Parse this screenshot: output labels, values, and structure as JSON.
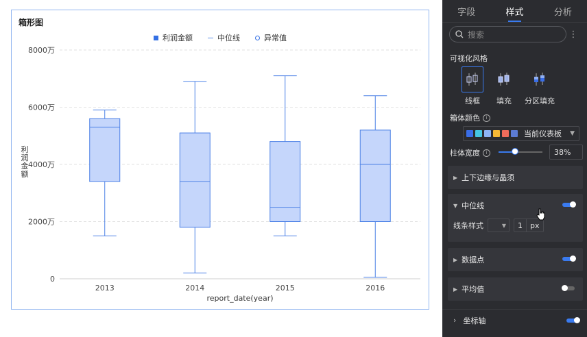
{
  "chart_data": {
    "type": "box",
    "title": "箱形图",
    "legend": [
      "利润金额",
      "中位线",
      "异常值"
    ],
    "xlabel": "report_date(year)",
    "ylabel": "利润金额",
    "ylim": [
      0,
      80000000
    ],
    "yticks": [
      0,
      20000000,
      40000000,
      60000000,
      80000000
    ],
    "ytick_labels": [
      "0",
      "2000万",
      "4000万",
      "6000万",
      "8000万"
    ],
    "categories": [
      "2013",
      "2014",
      "2015",
      "2016"
    ],
    "boxes": [
      {
        "min": 15000000,
        "q1": 34000000,
        "median": 53000000,
        "q3": 56000000,
        "max": 59000000
      },
      {
        "min": 2000000,
        "q1": 18000000,
        "median": 34000000,
        "q3": 51000000,
        "max": 69000000
      },
      {
        "min": 15000000,
        "q1": 20000000,
        "median": 25000000,
        "q3": 48000000,
        "max": 71000000
      },
      {
        "min": 500000,
        "q1": 20000000,
        "median": 40000000,
        "q3": 52000000,
        "max": 64000000
      }
    ],
    "colors": {
      "fill": "#c5d6fb",
      "stroke": "#4b80e6",
      "median": "#4b80e6"
    }
  },
  "panel": {
    "tabs": [
      {
        "label": "字段",
        "active": false
      },
      {
        "label": "样式",
        "active": true
      },
      {
        "label": "分析",
        "active": false
      }
    ],
    "search_placeholder": "搜索",
    "visual_style_label": "可视化风格",
    "style_options": [
      {
        "label": "线框",
        "selected": true
      },
      {
        "label": "填充",
        "selected": false
      },
      {
        "label": "分区填充",
        "selected": false
      }
    ],
    "box_color_label": "箱体颜色",
    "palette_label": "当前仪表板",
    "palette_colors": [
      "#3a6ee8",
      "#45c7e3",
      "#8db4f5",
      "#f5b835",
      "#ef6c5b",
      "#5c7bd3"
    ],
    "column_width_label": "柱体宽度",
    "column_width_value": "38%",
    "column_width_fraction": 0.38,
    "sections": {
      "whisker": {
        "label": "上下边缘与晶须"
      },
      "median": {
        "label": "中位线",
        "enabled": true,
        "line_style_label": "线条样式",
        "line_width": "1",
        "unit": "px"
      },
      "data_points": {
        "label": "数据点",
        "enabled": true
      },
      "mean": {
        "label": "平均值",
        "enabled": false
      },
      "axis": {
        "label": "坐标轴",
        "enabled": true
      }
    }
  }
}
